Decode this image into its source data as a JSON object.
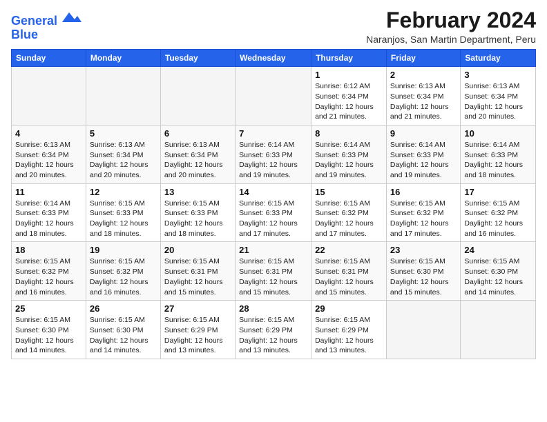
{
  "logo": {
    "line1": "General",
    "line2": "Blue"
  },
  "header": {
    "month": "February 2024",
    "location": "Naranjos, San Martin Department, Peru"
  },
  "weekdays": [
    "Sunday",
    "Monday",
    "Tuesday",
    "Wednesday",
    "Thursday",
    "Friday",
    "Saturday"
  ],
  "weeks": [
    [
      {
        "day": "",
        "info": ""
      },
      {
        "day": "",
        "info": ""
      },
      {
        "day": "",
        "info": ""
      },
      {
        "day": "",
        "info": ""
      },
      {
        "day": "1",
        "info": "Sunrise: 6:12 AM\nSunset: 6:34 PM\nDaylight: 12 hours and 21 minutes."
      },
      {
        "day": "2",
        "info": "Sunrise: 6:13 AM\nSunset: 6:34 PM\nDaylight: 12 hours and 21 minutes."
      },
      {
        "day": "3",
        "info": "Sunrise: 6:13 AM\nSunset: 6:34 PM\nDaylight: 12 hours and 20 minutes."
      }
    ],
    [
      {
        "day": "4",
        "info": "Sunrise: 6:13 AM\nSunset: 6:34 PM\nDaylight: 12 hours and 20 minutes."
      },
      {
        "day": "5",
        "info": "Sunrise: 6:13 AM\nSunset: 6:34 PM\nDaylight: 12 hours and 20 minutes."
      },
      {
        "day": "6",
        "info": "Sunrise: 6:13 AM\nSunset: 6:34 PM\nDaylight: 12 hours and 20 minutes."
      },
      {
        "day": "7",
        "info": "Sunrise: 6:14 AM\nSunset: 6:33 PM\nDaylight: 12 hours and 19 minutes."
      },
      {
        "day": "8",
        "info": "Sunrise: 6:14 AM\nSunset: 6:33 PM\nDaylight: 12 hours and 19 minutes."
      },
      {
        "day": "9",
        "info": "Sunrise: 6:14 AM\nSunset: 6:33 PM\nDaylight: 12 hours and 19 minutes."
      },
      {
        "day": "10",
        "info": "Sunrise: 6:14 AM\nSunset: 6:33 PM\nDaylight: 12 hours and 18 minutes."
      }
    ],
    [
      {
        "day": "11",
        "info": "Sunrise: 6:14 AM\nSunset: 6:33 PM\nDaylight: 12 hours and 18 minutes."
      },
      {
        "day": "12",
        "info": "Sunrise: 6:15 AM\nSunset: 6:33 PM\nDaylight: 12 hours and 18 minutes."
      },
      {
        "day": "13",
        "info": "Sunrise: 6:15 AM\nSunset: 6:33 PM\nDaylight: 12 hours and 18 minutes."
      },
      {
        "day": "14",
        "info": "Sunrise: 6:15 AM\nSunset: 6:33 PM\nDaylight: 12 hours and 17 minutes."
      },
      {
        "day": "15",
        "info": "Sunrise: 6:15 AM\nSunset: 6:32 PM\nDaylight: 12 hours and 17 minutes."
      },
      {
        "day": "16",
        "info": "Sunrise: 6:15 AM\nSunset: 6:32 PM\nDaylight: 12 hours and 17 minutes."
      },
      {
        "day": "17",
        "info": "Sunrise: 6:15 AM\nSunset: 6:32 PM\nDaylight: 12 hours and 16 minutes."
      }
    ],
    [
      {
        "day": "18",
        "info": "Sunrise: 6:15 AM\nSunset: 6:32 PM\nDaylight: 12 hours and 16 minutes."
      },
      {
        "day": "19",
        "info": "Sunrise: 6:15 AM\nSunset: 6:32 PM\nDaylight: 12 hours and 16 minutes."
      },
      {
        "day": "20",
        "info": "Sunrise: 6:15 AM\nSunset: 6:31 PM\nDaylight: 12 hours and 15 minutes."
      },
      {
        "day": "21",
        "info": "Sunrise: 6:15 AM\nSunset: 6:31 PM\nDaylight: 12 hours and 15 minutes."
      },
      {
        "day": "22",
        "info": "Sunrise: 6:15 AM\nSunset: 6:31 PM\nDaylight: 12 hours and 15 minutes."
      },
      {
        "day": "23",
        "info": "Sunrise: 6:15 AM\nSunset: 6:30 PM\nDaylight: 12 hours and 15 minutes."
      },
      {
        "day": "24",
        "info": "Sunrise: 6:15 AM\nSunset: 6:30 PM\nDaylight: 12 hours and 14 minutes."
      }
    ],
    [
      {
        "day": "25",
        "info": "Sunrise: 6:15 AM\nSunset: 6:30 PM\nDaylight: 12 hours and 14 minutes."
      },
      {
        "day": "26",
        "info": "Sunrise: 6:15 AM\nSunset: 6:30 PM\nDaylight: 12 hours and 14 minutes."
      },
      {
        "day": "27",
        "info": "Sunrise: 6:15 AM\nSunset: 6:29 PM\nDaylight: 12 hours and 13 minutes."
      },
      {
        "day": "28",
        "info": "Sunrise: 6:15 AM\nSunset: 6:29 PM\nDaylight: 12 hours and 13 minutes."
      },
      {
        "day": "29",
        "info": "Sunrise: 6:15 AM\nSunset: 6:29 PM\nDaylight: 12 hours and 13 minutes."
      },
      {
        "day": "",
        "info": ""
      },
      {
        "day": "",
        "info": ""
      }
    ]
  ]
}
